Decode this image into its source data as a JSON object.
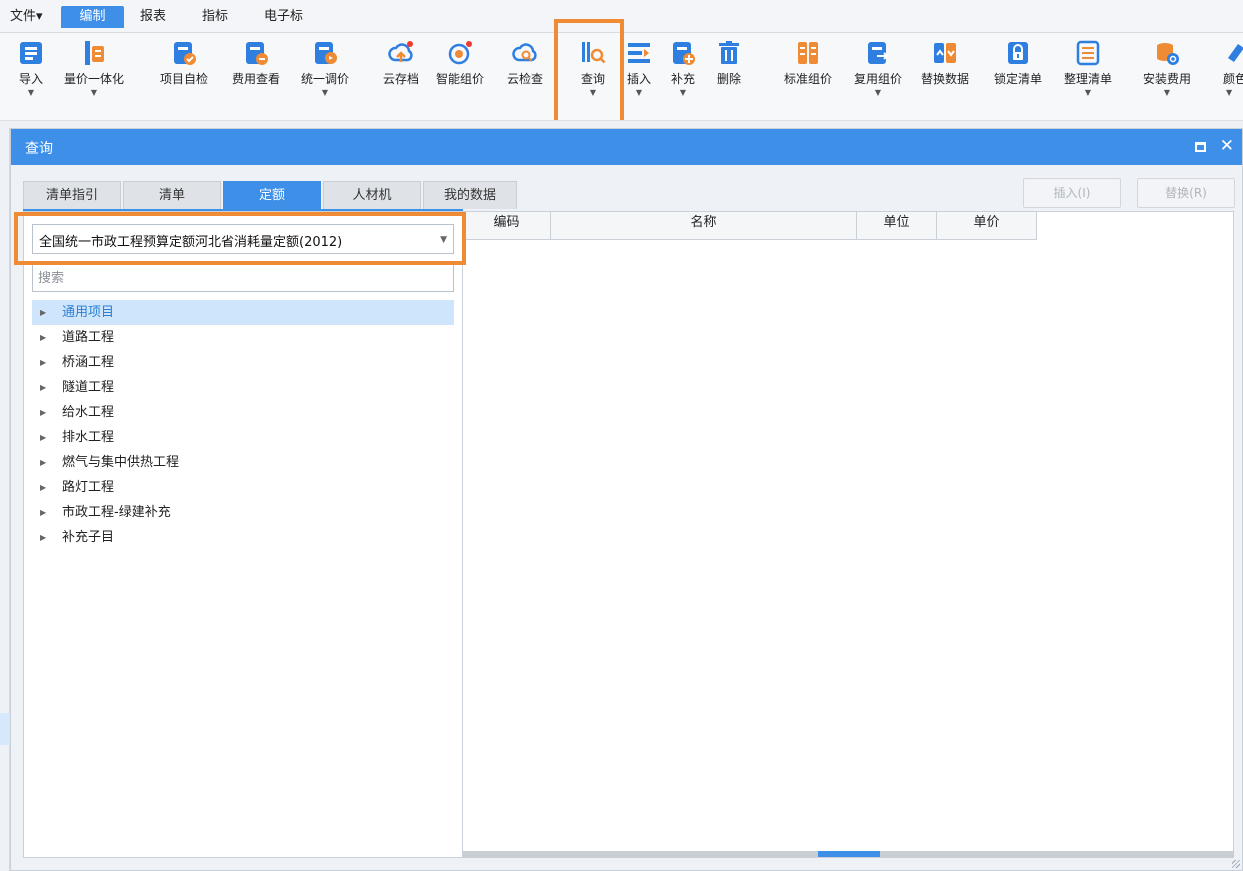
{
  "menubar": {
    "items": [
      {
        "label": "文件▾"
      },
      {
        "label": "编制",
        "active": true
      },
      {
        "label": "报表"
      },
      {
        "label": "指标"
      },
      {
        "label": "电子标"
      }
    ]
  },
  "ribbon": {
    "tools": [
      {
        "label": "导入",
        "icon": "import-icon",
        "dropdown": true
      },
      {
        "label": "量价一体化",
        "icon": "price-integration-icon",
        "dropdown": true
      },
      {
        "label": "项目自检",
        "icon": "project-check-icon"
      },
      {
        "label": "费用查看",
        "icon": "cost-view-icon"
      },
      {
        "label": "统一调价",
        "icon": "unified-price-icon",
        "dropdown": true
      },
      {
        "label": "云存档",
        "icon": "cloud-upload-icon"
      },
      {
        "label": "智能组价",
        "icon": "smart-pricing-icon"
      },
      {
        "label": "云检查",
        "icon": "cloud-check-icon"
      },
      {
        "label": "查询",
        "icon": "query-icon",
        "dropdown": true,
        "highlighted": true
      },
      {
        "label": "插入",
        "icon": "insert-icon",
        "dropdown": true
      },
      {
        "label": "补充",
        "icon": "supplement-icon",
        "dropdown": true
      },
      {
        "label": "删除",
        "icon": "delete-icon"
      },
      {
        "label": "标准组价",
        "icon": "standard-pricing-icon"
      },
      {
        "label": "复用组价",
        "icon": "reuse-pricing-icon",
        "dropdown": true
      },
      {
        "label": "替换数据",
        "icon": "replace-data-icon"
      },
      {
        "label": "锁定清单",
        "icon": "lock-list-icon"
      },
      {
        "label": "整理清单",
        "icon": "organize-list-icon",
        "dropdown": true
      },
      {
        "label": "安装费用",
        "icon": "install-cost-icon",
        "dropdown": true
      },
      {
        "label": "颜色",
        "icon": "color-icon",
        "dropdown": true
      }
    ]
  },
  "dialog": {
    "title": "查询",
    "tabs": [
      {
        "label": "清单指引"
      },
      {
        "label": "清单"
      },
      {
        "label": "定额",
        "active": true
      },
      {
        "label": "人材机"
      },
      {
        "label": "我的数据"
      }
    ],
    "buttons": {
      "insert": "插入(I)",
      "replace": "替换(R)"
    },
    "quota_library": "全国统一市政工程预算定额河北省消耗量定额(2012)",
    "search_placeholder": "搜索",
    "tree": [
      {
        "label": "通用项目",
        "selected": true
      },
      {
        "label": "道路工程"
      },
      {
        "label": "桥涵工程"
      },
      {
        "label": "隧道工程"
      },
      {
        "label": "给水工程"
      },
      {
        "label": "排水工程"
      },
      {
        "label": "燃气与集中供热工程"
      },
      {
        "label": "路灯工程"
      },
      {
        "label": "市政工程-绿建补充"
      },
      {
        "label": "补充子目"
      }
    ],
    "grid": {
      "columns": [
        "编码",
        "名称",
        "单位",
        "单价"
      ],
      "rows": []
    }
  },
  "colors": {
    "accent": "#3d8fe8",
    "highlight": "#f08b35"
  }
}
